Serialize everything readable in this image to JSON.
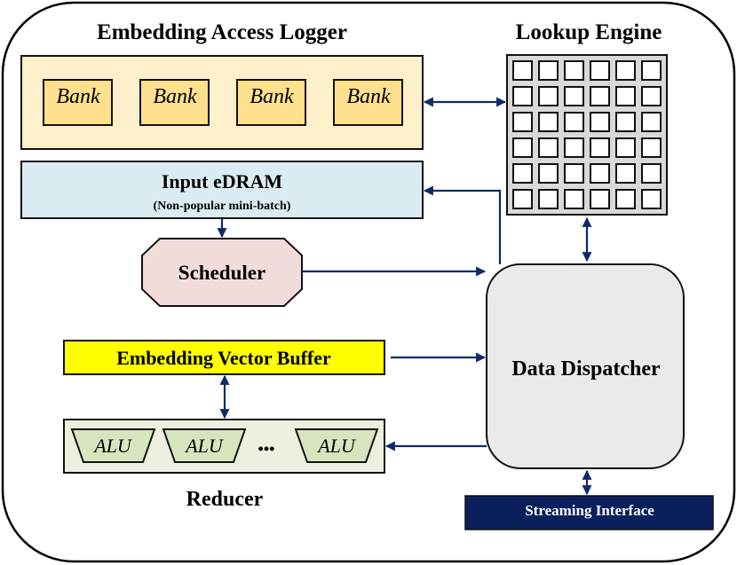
{
  "logger": {
    "title": "Embedding Access Logger",
    "banks": [
      "Bank",
      "Bank",
      "Bank",
      "Bank"
    ]
  },
  "lookup": {
    "title": "Lookup Engine",
    "rows": 6,
    "cols": 6
  },
  "edram": {
    "title": "Input eDRAM",
    "subtitle": "(Non-popular mini-batch)"
  },
  "scheduler": {
    "label": "Scheduler"
  },
  "evb": {
    "label": "Embedding Vector Buffer"
  },
  "dispatcher": {
    "label": "Data Dispatcher"
  },
  "reducer": {
    "label": "Reducer",
    "alus": [
      "ALU",
      "ALU",
      "ALU"
    ],
    "ellipsis": "•••"
  },
  "streaming": {
    "label": "Streaming Interface"
  },
  "colors": {
    "arrow": "#0E2A6B",
    "logger": "#FFF0CC",
    "bank": "#FFE08F",
    "edram": "#DAECF2",
    "scheduler": "#F2DCDB",
    "grid": "#D9D9D9",
    "dispatcher": "#EAEAEA",
    "evb": "#FFFF00",
    "reducer": "#EBF1DE",
    "alu": "#D7E4BD",
    "streaming": "#0A1F5C"
  }
}
